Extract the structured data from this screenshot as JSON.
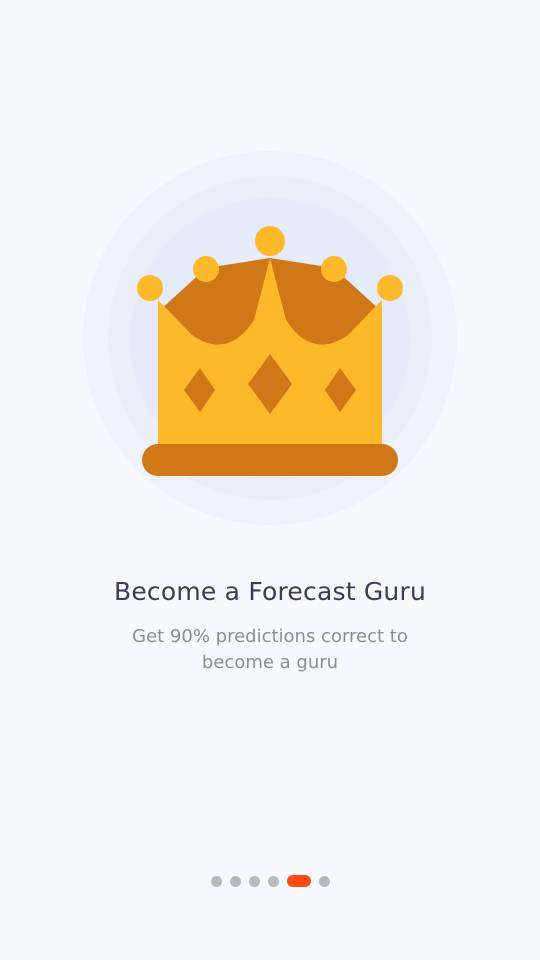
{
  "onboarding": {
    "title": "Become a Forecast Guru",
    "subtitle": "Get 90% predictions correct to become a guru",
    "illustration_icon": "crown-icon"
  },
  "pager": {
    "total_pages": 6,
    "active_page": 5
  },
  "colors": {
    "background": "#f6f8fc",
    "title": "#3a3d56",
    "subtitle": "#8a8d99",
    "pager_dot": "#b8b9bf",
    "pager_active": "#ff4a12",
    "crown_gold": "#fdb92a",
    "crown_bronze": "#d07718"
  }
}
